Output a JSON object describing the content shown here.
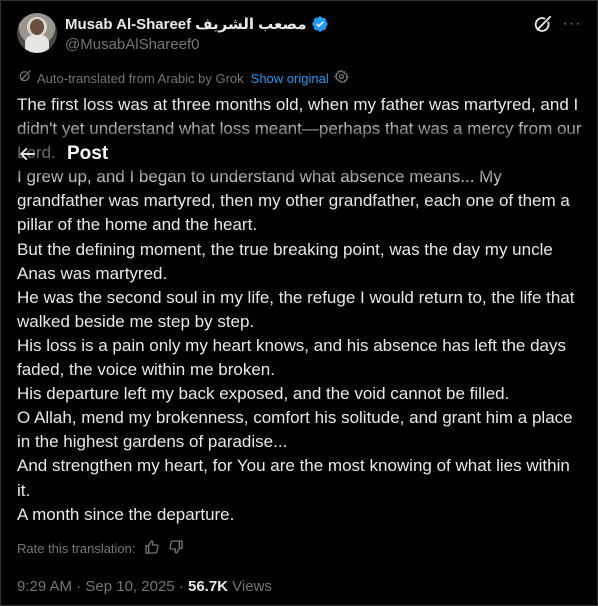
{
  "author": {
    "name": "Musab Al-Shareef",
    "name_arabic": "مصعب الشريف",
    "handle": "@MusabAlShareef0"
  },
  "translation": {
    "notice": "Auto-translated from Arabic by Grok",
    "show_original": "Show original",
    "rate_label": "Rate this translation:"
  },
  "sticky_header": {
    "title": "Post"
  },
  "post": {
    "lines": [
      " The first loss was at three months old, when my father was martyred, and I didn't yet understand what loss meant—perhaps that was a mercy from our Lord.",
      "I grew up, and I began to understand what absence means... My grandfather was martyred, then my other grandfather, each one of them a pillar of the home and the heart.",
      "But the defining moment, the true breaking point, was the day my uncle Anas was martyred.",
      "He was the second soul in my life, the refuge I would return to, the life that walked beside me step by step.",
      "His loss is a pain only my heart knows, and his absence has left the days faded, the voice within me broken.",
      "His departure left my back exposed, and the void cannot be filled.",
      "O Allah, mend my brokenness, comfort his solitude, and grant him a place in the highest gardens of paradise...",
      "And strengthen my heart, for You are the most knowing of what lies within it.",
      "A month since the departure."
    ]
  },
  "meta": {
    "time": "9:29 AM",
    "separator": " · ",
    "date": "Sep 10, 2025",
    "views_count": "56.7K",
    "views_label": " Views"
  },
  "colors": {
    "background": "#000000",
    "text": "#e7e9ea",
    "muted": "#71767b",
    "accent": "#1d9bf0"
  },
  "icons": [
    "verified-badge-icon",
    "grok-icon",
    "more-icon",
    "settings-gear-icon",
    "back-arrow-icon",
    "thumbs-up-icon",
    "thumbs-down-icon"
  ]
}
